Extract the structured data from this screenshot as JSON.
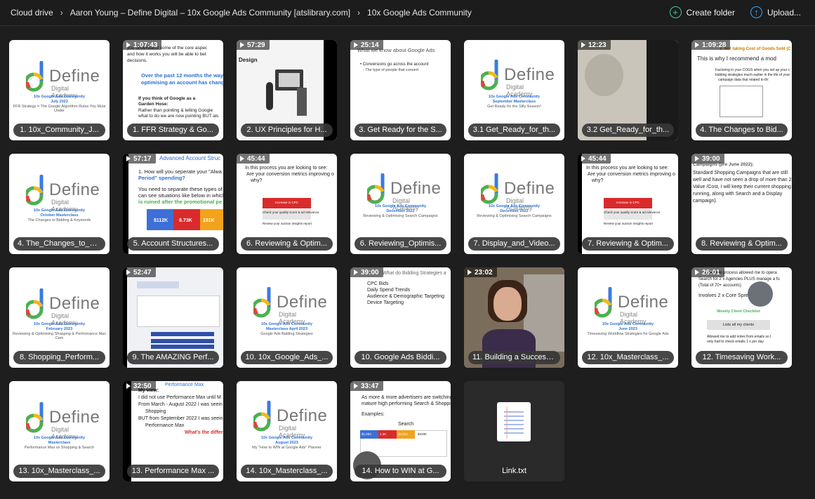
{
  "breadcrumb": [
    "Cloud drive",
    "Aaron Young – Define Digital – 10x Google Ads Community [atslibrary.com]",
    "10x Google Ads Community"
  ],
  "actions": {
    "create_folder": "Create folder",
    "upload": "Upload..."
  },
  "brand": {
    "word": "Define",
    "sub": "Digital Academy"
  },
  "tiles": [
    {
      "label": "1. 10x_Community_J...",
      "duration": "",
      "caps": [
        "10x Google Ads Community",
        "July 2022",
        "FFR Strategy = The Google Algorithm Rules You Must Under"
      ]
    },
    {
      "label": "1. FFR Strategy & Go...",
      "duration": "1:07:43",
      "text": [
        "you understand some of the core aspec",
        "and how it works you will be able to bet",
        "decisions.",
        "Over the past 12 months the way you",
        "optimising an account has changed.",
        "If you think of Google as a",
        "Garden Hose:",
        "Rather than pointing & telling Google",
        "what to do we are now pointing BUT als"
      ]
    },
    {
      "label": "2. UX Principles for H...",
      "duration": "57:29",
      "text": [
        "Design"
      ]
    },
    {
      "label": "3. Get Ready for the S...",
      "duration": "25:14",
      "text": [
        "What we know about Google Ads",
        "• Conversions go across the account",
        "- The type of people that convert"
      ]
    },
    {
      "label": "3.1 Get_Ready_for_th...",
      "duration": "",
      "caps": [
        "10x Google Ads Community",
        "September Masterclass",
        "Get Ready for the Silly Season!"
      ]
    },
    {
      "label": "3.2 Get_Ready_for_th...",
      "duration": "12:23"
    },
    {
      "label": "4. The Changes to Bid...",
      "duration": "1:09:28",
      "text": [
        "3. Not taking Cost of Goods Sold (C",
        "This is why I recommend a mod",
        "Factoring in your COGS when you set up your c",
        "bidding strategies much earlier in the life of your",
        "campaign data that related to thi"
      ]
    },
    {
      "label": "4. The_Changes_to_Bi...",
      "duration": "",
      "caps": [
        "10x Google Ads Community",
        "October Masterclass",
        "The Changes to Bidding & Keywords"
      ]
    },
    {
      "label": "5. Account Structures...",
      "duration": "57:17",
      "text": [
        "Advanced Account Struc",
        "1. How will you seperate your \"Alwa",
        "Period\" spending?",
        "You need to separate these types of",
        "can see situations like below in which",
        "is ruined after the promotional pe",
        "$112K",
        "8.73K",
        "151K"
      ]
    },
    {
      "label": "6. Reviewing & Optim...",
      "duration": "45:44",
      "text": [
        "In this process you are looking to see:",
        "Are your conversion metrics improving o",
        "why?",
        "Increase in CPC",
        "Check your quality score & ad relevance",
        "Review your auction insights report"
      ]
    },
    {
      "label": "6. Reviewing_Optimis...",
      "duration": "",
      "caps": [
        "10x Google Ads Community",
        "December 2022",
        "Reviewing & Optimising Search Campaigns"
      ]
    },
    {
      "label": "7. Display_and_Video...",
      "duration": "",
      "caps": [
        "10x Google Ads Community",
        "December 2022",
        "Reviewing & Optimising Search Campaigns"
      ]
    },
    {
      "label": "7. Reviewing & Optim...",
      "duration": "45:44",
      "text": [
        "In this process you are looking to see:",
        "Are your conversion metrics improving o",
        "why?",
        "Increase in CPC",
        "Check your quality score & ad relevance",
        "Review your auction insights report"
      ]
    },
    {
      "label": "8. Reviewing & Optim...",
      "duration": "39:00",
      "text": [
        "Campaigns (pre June 2022):",
        "Standard Shopping Campaigns that are still",
        "well and have not seen a drop of more than 2 i",
        "Value /Cost, I will keep their current shopping",
        "running, along with Search and a Display",
        "campaign)."
      ]
    },
    {
      "label": "8. Shopping_Perform...",
      "duration": "",
      "caps": [
        "10x Google Ads Community",
        "February 2023",
        "Reviewing & Optimising Shopping & Performance Max Cam"
      ]
    },
    {
      "label": "9. The AMAZING Perf...",
      "duration": "52:47"
    },
    {
      "label": "10. 10x_Google_Ads_...",
      "duration": "",
      "caps": [
        "10x Google Ads Community",
        "Masterclass April 2023",
        "Google Ads Bidding Strategies"
      ]
    },
    {
      "label": "10. Google Ads Biddi...",
      "duration": "39:00",
      "text": [
        "What do Bidding Strategies a",
        "CPC Bids",
        "Daily Spend Trends",
        "Audience & Demographic Targeting",
        "Device Targeting"
      ]
    },
    {
      "label": "11. Building a Success...",
      "duration": "23:02"
    },
    {
      "label": "12. 10x_Masterclass_...",
      "duration": "",
      "caps": [
        "10x Google Ads Community",
        "June 2023",
        "Timesaving Workflow Strategies for Google Ads"
      ]
    },
    {
      "label": "12. Timesaving Work...",
      "duration": "26:01",
      "text": [
        "workflow process allowed me to opera",
        "Search for 2 x Agencies PLUS manage a fu",
        "(Total of 70+ accounts)",
        "Involves 2 x Core Spreads",
        "Weekly Client Checklist",
        "Lists all my clients",
        "Allowed me to add notes from emails so I",
        "only had to check emails 1 x per day"
      ]
    },
    {
      "label": "13. 10x_Masterclass_...",
      "duration": "",
      "caps": [
        "10x Google Ads Community",
        "Masterclass",
        "Performance Max vs Shopping & Search"
      ]
    },
    {
      "label": "13. Performance Max ...",
      "duration": "32:50",
      "text": [
        "Performance Max",
        "My view:",
        "I did not use Performance Max until M",
        "From March - August 2022 I was seein",
        "Shopping",
        "BUT from September 2022 I was seein",
        "Performance Max",
        "What's the differe"
      ]
    },
    {
      "label": "14. 10x_Masterclass_...",
      "duration": "",
      "caps": [
        "10x Google Ads Community",
        "August 2023",
        "My \"How to WIN at Google Ads\" Planner"
      ]
    },
    {
      "label": "14. How to WIN at G...",
      "duration": "33:47",
      "text": [
        "As more & more advertisers are switching o",
        "mature high performing Search & Shopping",
        "Examples:",
        "Search",
        "$1,094",
        "1.3K",
        "$3,003",
        "$316K"
      ]
    },
    {
      "label": "Link.txt",
      "duration": ""
    }
  ],
  "colors": {
    "accent_green": "#41c7a4",
    "accent_blue": "#3ba4f5",
    "brand_blue": "#2b6fd6",
    "red": "#d92b2b"
  }
}
